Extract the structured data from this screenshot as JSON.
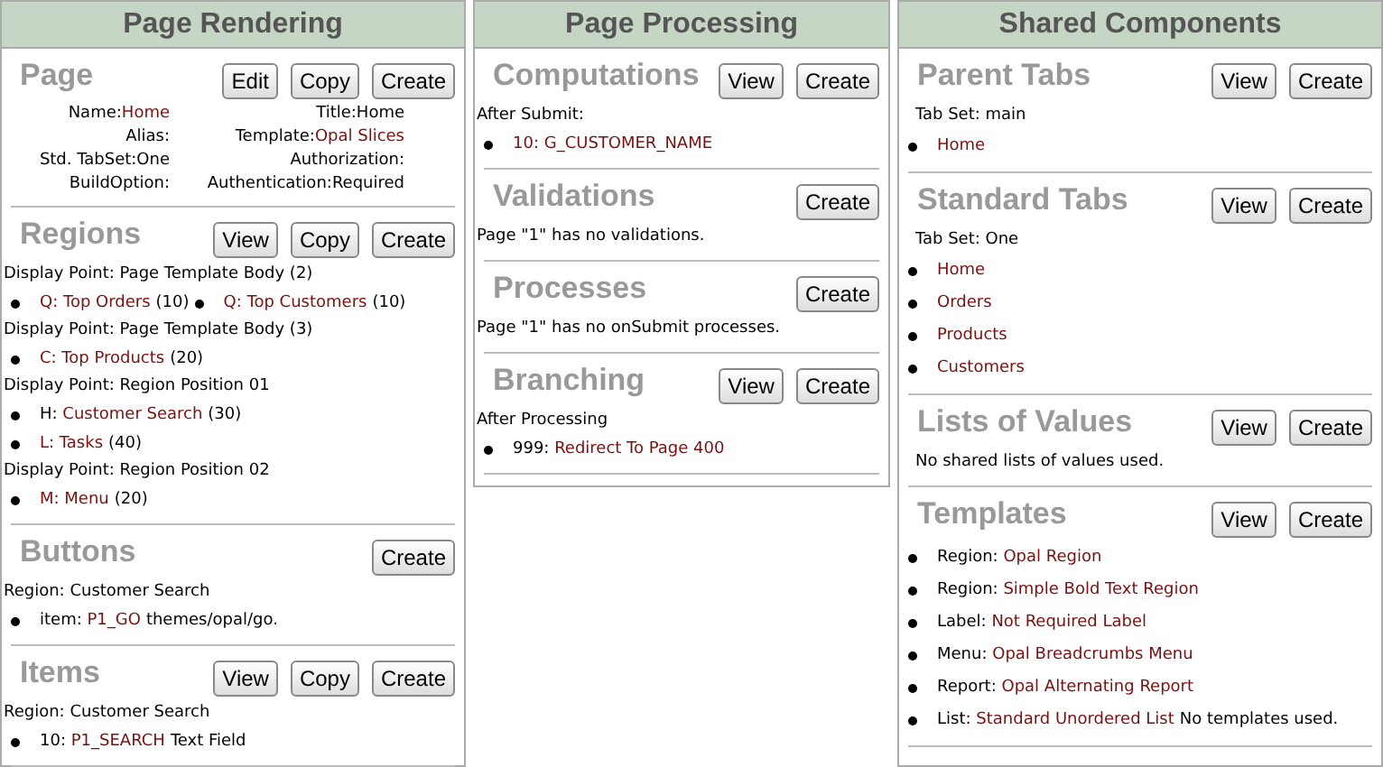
{
  "columns": [
    {
      "title": "Page Rendering",
      "sections": [
        {
          "title": "Page",
          "buttons": [
            "Edit",
            "Copy",
            "Create"
          ],
          "lines": [
            {
              "kind": "fields",
              "fields": [
                {
                  "label": "Name:",
                  "link": "Home"
                },
                {
                  "label": "Title:",
                  "value": "Home"
                },
                {
                  "label": "Alias:"
                },
                {
                  "label": "Template:",
                  "link": "Opal Slices"
                },
                {
                  "label": "Std. TabSet:",
                  "value": "One"
                },
                {
                  "label": "Authorization:"
                },
                {
                  "label": "BuildOption:"
                },
                {
                  "label": "Authentication:",
                  "value": "Required"
                }
              ]
            }
          ]
        },
        {
          "title": "Regions",
          "buttons": [
            "View",
            "Copy",
            "Create"
          ],
          "lines": [
            {
              "kind": "text",
              "text": "Display Point: Page Template Body (2)"
            },
            {
              "kind": "bullet-row",
              "items": [
                {
                  "link": "Q: Top Orders",
                  "suffix": "(10)"
                },
                {
                  "link": "Q: Top Customers",
                  "suffix": "(10)"
                }
              ]
            },
            {
              "kind": "text",
              "text": "Display Point: Page Template Body (3)"
            },
            {
              "kind": "bullet",
              "link": "C: Top Products",
              "suffix": "(20)"
            },
            {
              "kind": "text",
              "text": "Display Point: Region Position 01"
            },
            {
              "kind": "bullet",
              "prefix": "H: ",
              "link": "Customer Search",
              "suffix": "(30)"
            },
            {
              "kind": "bullet",
              "link": "L: Tasks",
              "suffix": "(40)"
            },
            {
              "kind": "text",
              "text": "Display Point: Region Position 02"
            },
            {
              "kind": "bullet",
              "link": "M: Menu",
              "suffix": "(20)"
            }
          ]
        },
        {
          "title": "Buttons",
          "buttons": [
            "Create"
          ],
          "lines": [
            {
              "kind": "text",
              "text": "Region: Customer Search"
            },
            {
              "kind": "bullet",
              "prefix": "item: ",
              "link": "P1_GO",
              "suffix": "themes/opal/go."
            }
          ]
        },
        {
          "title": "Items",
          "buttons": [
            "View",
            "Copy",
            "Create"
          ],
          "lines": [
            {
              "kind": "text",
              "text": "Region: Customer Search"
            },
            {
              "kind": "bullet",
              "prefix": "10: ",
              "link": "P1_SEARCH",
              "suffix": "Text Field"
            }
          ]
        }
      ]
    },
    {
      "title": "Page Processing",
      "sections": [
        {
          "title": "Computations",
          "buttons": [
            "View",
            "Create"
          ],
          "lines": [
            {
              "kind": "text",
              "text": "After Submit:"
            },
            {
              "kind": "bullet",
              "link": "10: G_CUSTOMER_NAME"
            }
          ]
        },
        {
          "title": "Validations",
          "buttons": [
            "Create"
          ],
          "lines": [
            {
              "kind": "text",
              "text": "Page \"1\" has no validations."
            }
          ]
        },
        {
          "title": "Processes",
          "buttons": [
            "Create"
          ],
          "lines": [
            {
              "kind": "text",
              "text": "Page \"1\" has no onSubmit processes."
            }
          ]
        },
        {
          "title": "Branching",
          "buttons": [
            "View",
            "Create"
          ],
          "lines": [
            {
              "kind": "text",
              "text": "After Processing"
            },
            {
              "kind": "bullet",
              "prefix": "999: ",
              "link": "Redirect To Page  400"
            }
          ]
        }
      ]
    },
    {
      "title": "Shared Components",
      "sections": [
        {
          "title": "Parent Tabs",
          "buttons": [
            "View",
            "Create"
          ],
          "lines": [
            {
              "kind": "text",
              "text": "Tab Set: main"
            },
            {
              "kind": "bullet",
              "link": "Home"
            }
          ]
        },
        {
          "title": "Standard Tabs",
          "buttons": [
            "View",
            "Create"
          ],
          "lines": [
            {
              "kind": "text",
              "text": "Tab Set: One"
            },
            {
              "kind": "bullet",
              "link": "Home"
            },
            {
              "kind": "bullet",
              "link": "Orders"
            },
            {
              "kind": "bullet",
              "link": "Products"
            },
            {
              "kind": "bullet",
              "link": "Customers"
            }
          ]
        },
        {
          "title": "Lists of Values",
          "buttons": [
            "View",
            "Create"
          ],
          "lines": [
            {
              "kind": "text",
              "text": "No shared lists of values used."
            }
          ]
        },
        {
          "title": "Templates",
          "buttons": [
            "View",
            "Create"
          ],
          "lines": [
            {
              "kind": "bullet",
              "prefix": "Region: ",
              "link": "Opal Region"
            },
            {
              "kind": "bullet",
              "prefix": "Region: ",
              "link": "Simple Bold Text Region"
            },
            {
              "kind": "bullet",
              "prefix": "Label: ",
              "link": "Not Required Label"
            },
            {
              "kind": "bullet",
              "prefix": "Menu: ",
              "link": "Opal Breadcrumbs Menu"
            },
            {
              "kind": "bullet",
              "prefix": "Report: ",
              "link": "Opal Alternating Report"
            },
            {
              "kind": "bullet",
              "prefix": "List: ",
              "link": "Standard Unordered List",
              "suffix": "No templates used."
            }
          ]
        }
      ]
    }
  ]
}
